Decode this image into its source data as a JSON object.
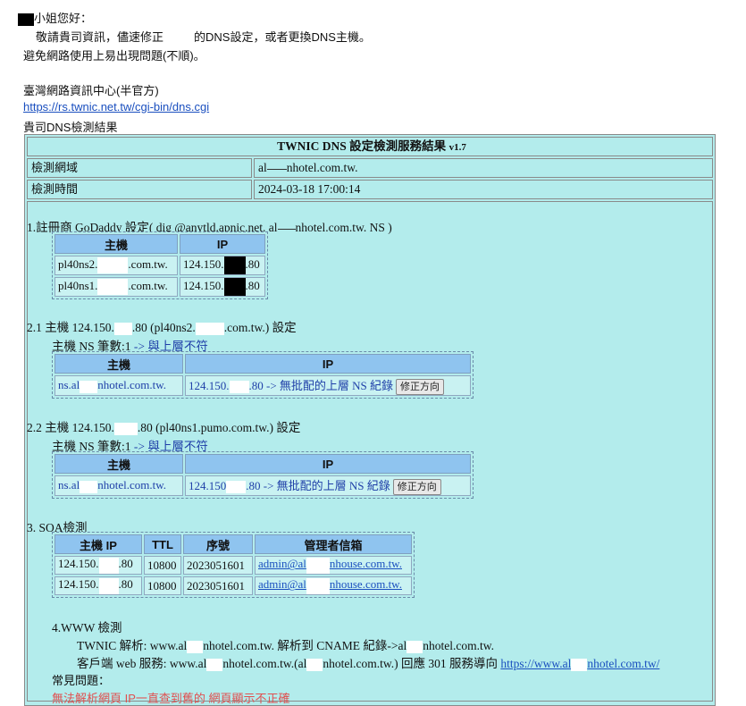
{
  "email": {
    "greeting": "小姐您好：",
    "line1a": "敬請貴司資訊，儘速修正",
    "line1b": "的DNS設定，或者更換DNS主機。",
    "line2": "避免網路使用上易出現問題(不順)。",
    "org_name": "臺灣網路資訊中心(半官方)",
    "org_link": "https://rs.twnic.net.tw/cgi-bin/dns.cgi",
    "result_label": "貴司DNS檢測結果"
  },
  "report": {
    "title": "TWNIC DNS 設定檢測服務結果",
    "version": "v1.7",
    "domain_label": "檢測網域",
    "domain_value_a": "al",
    "domain_value_b": "nhotel.com.tw.",
    "time_label": "檢測時間",
    "time_value": "2024-03-18 17:00:14",
    "s1_title_a": "1.註冊商 GoDaddy 設定( dig @anytld.apnic.net. al",
    "s1_title_b": "nhotel.com.tw. NS )",
    "s1_headers": [
      "主機",
      "IP"
    ],
    "s1_rows": [
      {
        "host_a": "pl40ns2.",
        "host_b": ".com.tw.",
        "ip_a": "124.150.",
        "ip_b": ".80"
      },
      {
        "host_a": "pl40ns1.",
        "host_b": ".com.tw.",
        "ip_a": "124.150.",
        "ip_b": ".80"
      }
    ],
    "s21_title_a": "2.1 主機 124.150.",
    "s21_title_b": ".80 (pl40ns2.",
    "s21_title_c": ".com.tw.) 設定",
    "s21_ns_count": "主機 NS 筆數:1",
    "s21_ns_note": "-> 與上層不符",
    "s21_headers": [
      "主機",
      "IP"
    ],
    "s21_host_a": "ns.al",
    "s21_host_b": "nhotel.com.tw.",
    "s21_ip_a": "124.150.",
    "s21_ip_b": ".80 -> 無批配的上層 NS 紀錄",
    "s21_button": "修正方向",
    "s22_title_a": "2.2 主機 124.150.",
    "s22_title_b": ".80 (pl40ns1.pumo.com.tw.) 設定",
    "s22_ns_count": "主機 NS 筆數:1",
    "s22_ns_note": "-> 與上層不符",
    "s22_headers": [
      "主機",
      "IP"
    ],
    "s22_host_a": "ns.al",
    "s22_host_b": "nhotel.com.tw.",
    "s22_ip_a": "124.150",
    "s22_ip_b": ".80 -> 無批配的上層 NS 紀錄",
    "s22_button": "修正方向",
    "s3_title": "3. SOA檢測",
    "s3_headers": [
      "主機 IP",
      "TTL",
      "序號",
      "管理者信箱"
    ],
    "s3_rows": [
      {
        "ip_a": "124.150.",
        "ip_b": ".80",
        "ttl": "10800",
        "serial": "2023051601",
        "mail_a": "admin@al",
        "mail_b": "nhouse.com.tw."
      },
      {
        "ip_a": "124.150.",
        "ip_b": ".80",
        "ttl": "10800",
        "serial": "2023051601",
        "mail_a": "admin@al",
        "mail_b": "nhouse.com.tw."
      }
    ],
    "s4_title": "4.WWW 檢測",
    "s4_line1_a": "TWNIC 解析: www.al",
    "s4_line1_b": "nhotel.com.tw. 解析到 CNAME 紀錄->al",
    "s4_line1_c": "nhotel.com.tw.",
    "s4_line2_a": "客戶端 web 服務: www.al",
    "s4_line2_b": "nhotel.com.tw.(al",
    "s4_line2_c": "nhotel.com.tw.) 回應 301 服務導向",
    "s4_line2_link_a": "https://www.al",
    "s4_line2_link_b": "nhotel.com.tw/",
    "faq_label": "常見問題：",
    "faq_item": "無法解析網頁 IP一直查到舊的 網頁顯示不正確"
  },
  "colors": {
    "report_bg": "#b3ecec",
    "header_cell": "#8fc4ef",
    "link": "#1a4fbf",
    "faq_red": "#e05050"
  }
}
